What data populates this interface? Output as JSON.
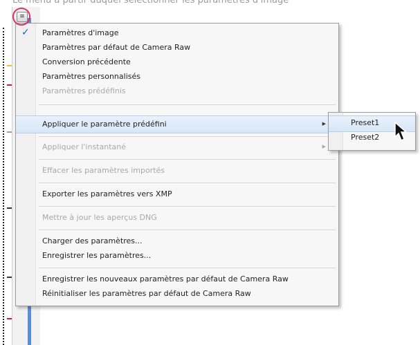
{
  "caption": "Le menu à partir duquel sélectionner les paramètres d'image",
  "menu_button": {
    "icon": "menu-list-icon",
    "glyph": "≡"
  },
  "menu": {
    "group1": [
      {
        "label": "Paramètres d'image",
        "checked": true,
        "disabled": false
      },
      {
        "label": "Paramètres par défaut de Camera Raw",
        "checked": false,
        "disabled": false
      },
      {
        "label": "Conversion précédente",
        "checked": false,
        "disabled": false
      },
      {
        "label": "Paramètres personnalisés",
        "checked": false,
        "disabled": false
      },
      {
        "label": "Paramètres prédéfinis",
        "checked": false,
        "disabled": true
      }
    ],
    "apply_preset": "Appliquer le paramètre prédéfini",
    "apply_snapshot": "Appliquer l'instantané",
    "clear_imported": "Effacer les paramètres importés",
    "export_xmp": "Exporter les paramètres vers XMP",
    "update_dng": "Mettre à jour les aperçus DNG",
    "load_settings": "Charger des paramètres...",
    "save_settings": "Enregistrer les paramètres...",
    "save_defaults": "Enregistrer les nouveaux paramètres par défaut de Camera Raw",
    "reset_defaults": "Réinitialiser les paramètres par défaut de Camera Raw",
    "submenu_arrow": "▶"
  },
  "submenu": {
    "items": [
      "Preset1",
      "Preset2"
    ]
  },
  "colors": {
    "highlight_circle": "#d6336c",
    "check": "#2a5bd7",
    "accent_bar": "#5a8fd6"
  }
}
